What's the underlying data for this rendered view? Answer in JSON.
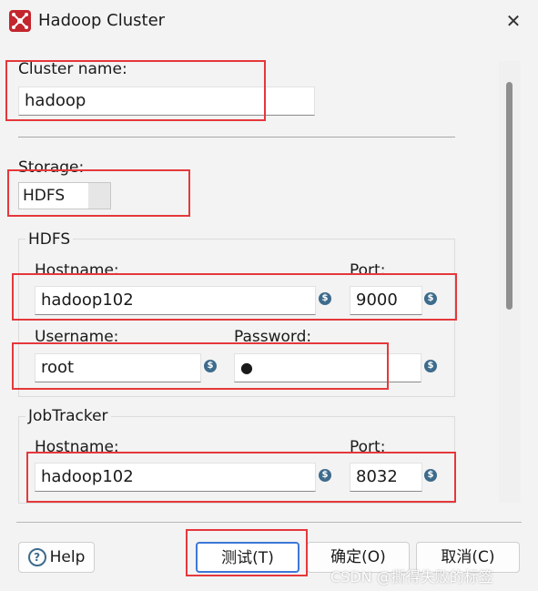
{
  "window": {
    "title": "Hadoop Cluster",
    "close_glyph": "✕",
    "app_icon": "hadoop-cluster-icon"
  },
  "cluster": {
    "name_label": "Cluster name:",
    "name_value": "hadoop"
  },
  "storage": {
    "label": "Storage:",
    "selected": "HDFS"
  },
  "hdfs": {
    "group_title": "HDFS",
    "hostname_label": "Hostname:",
    "hostname_value": "hadoop102",
    "port_label": "Port:",
    "port_value": "9000",
    "username_label": "Username:",
    "username_value": "root",
    "password_label": "Password:",
    "password_value": "●"
  },
  "jobtracker": {
    "group_title": "JobTracker",
    "hostname_label": "Hostname:",
    "hostname_value": "hadoop102",
    "port_label": "Port:",
    "port_value": "8032"
  },
  "variable_icon_glyph": "$",
  "buttons": {
    "help": "Help",
    "help_glyph": "?",
    "test": "测试(T)",
    "ok": "确定(O)",
    "cancel": "取消(C)"
  },
  "watermark": "CSDN @撕得失败的标签",
  "colors": {
    "highlight": "#e5383b",
    "brand": "#c4262e",
    "variable_icon": "#3d6b8c"
  }
}
